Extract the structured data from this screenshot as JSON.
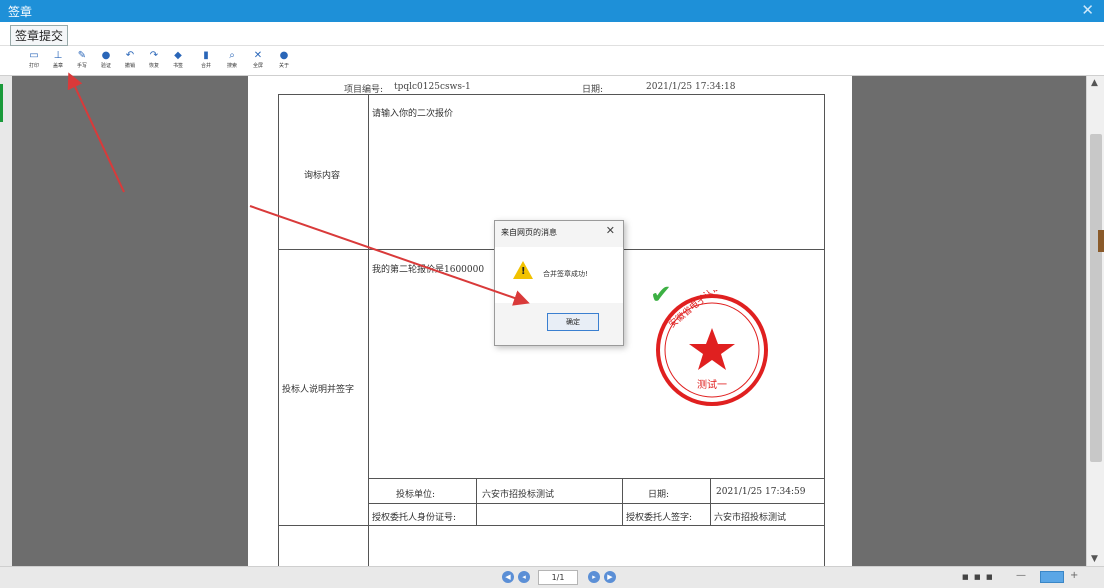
{
  "window": {
    "title": "签章",
    "close": "✕"
  },
  "menu": {
    "item": "签章提交"
  },
  "toolbar": {
    "items": [
      {
        "icon": "printer-icon",
        "glyph": "▭",
        "label": "打印"
      },
      {
        "icon": "stamp-icon",
        "glyph": "⊥",
        "label": "盖章"
      },
      {
        "icon": "handwrite-icon",
        "glyph": "✎",
        "label": "手写"
      },
      {
        "icon": "verify-icon",
        "glyph": "●",
        "label": "验证"
      },
      {
        "icon": "undo-icon",
        "glyph": "↶",
        "label": "撤销"
      },
      {
        "icon": "redo-icon",
        "glyph": "↷",
        "label": "恢复"
      },
      {
        "icon": "bookmark-icon",
        "glyph": "◆",
        "label": "书签"
      },
      {
        "icon": "merge-icon",
        "glyph": "▮",
        "label": "合并"
      },
      {
        "icon": "search-icon",
        "glyph": "⌕",
        "label": "搜索"
      },
      {
        "icon": "fullscreen-icon",
        "glyph": "✕",
        "label": "全屏"
      },
      {
        "icon": "about-icon",
        "glyph": "●",
        "label": "关于"
      }
    ]
  },
  "document": {
    "project_label": "项目编号:",
    "project_value": "tpqlc0125csws-1",
    "date_label": "日期:",
    "date_value": "2021/1/25 17:34:18",
    "inquiry_label": "询标内容",
    "inquiry_text": "请输入你的二次报价",
    "bidder_label": "投标人说明并签字",
    "bidder_text": "我的第二轮报价是1600000",
    "unit_label": "投标单位:",
    "unit_value": "六安市招投标测试",
    "sign_date_label": "日期:",
    "sign_date_value": "2021/1/25 17:34:59",
    "id_label": "授权委托人身份证号:",
    "id_value": "",
    "signer_label": "授权委托人签字:",
    "signer_value": "六安市招投标测试"
  },
  "stamp": {
    "center_text": "测试一",
    "ring_text": "安徽省电子认证管理中心",
    "color": "#e02020"
  },
  "dialog": {
    "title": "来自网页的消息",
    "message": "合并签章成功!",
    "ok_label": "确定"
  },
  "statusbar": {
    "page_indicator": "1/1",
    "zoom_minus": "—",
    "zoom_plus": "+"
  },
  "colors": {
    "titlebar": "#1e90d8",
    "annotation_arrow": "#d93a3a"
  }
}
